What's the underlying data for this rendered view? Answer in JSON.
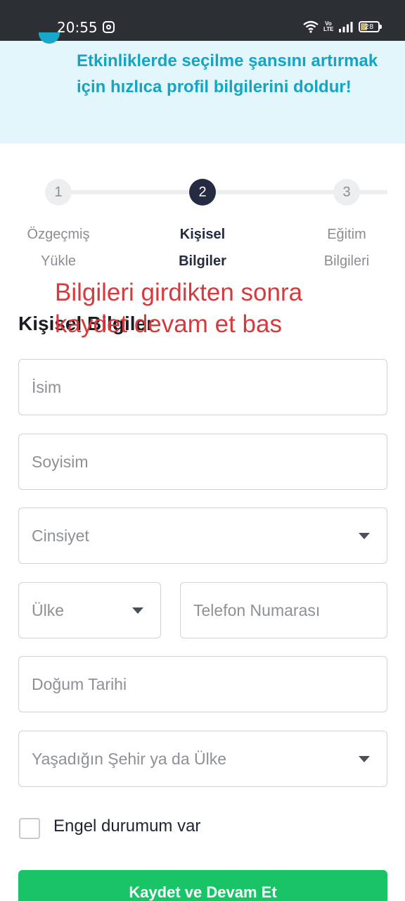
{
  "status_bar": {
    "time": "20:55",
    "battery": "28",
    "network_label": "Vo LTE"
  },
  "banner": {
    "text": "Etkinliklerde seçilme şansını artırmak için hızlıca profil bilgilerini doldur!",
    "accent_color": "#14a5c4",
    "background_color": "#e3f6fb"
  },
  "stepper": {
    "steps": [
      {
        "number": "1",
        "label_line1": "Özgeçmiş",
        "label_line2": "Yükle",
        "state": "inactive"
      },
      {
        "number": "2",
        "label_line1": "Kişisel",
        "label_line2": "Bilgiler",
        "state": "active"
      },
      {
        "number": "3",
        "label_line1": "Eğitim",
        "label_line2": "Bilgileri",
        "state": "inactive"
      }
    ]
  },
  "section_title": "Kişisel Bilgiler",
  "overlay_note": "Bilgileri girdikten sonra kaydet devam et bas",
  "form": {
    "name_placeholder": "İsim",
    "surname_placeholder": "Soyisim",
    "gender_placeholder": "Cinsiyet",
    "country_placeholder": "Ülke",
    "phone_placeholder": "Telefon Numarası",
    "birthdate_placeholder": "Doğum Tarihi",
    "city_placeholder": "Yaşadığın Şehir ya da Ülke",
    "disability_label": "Engel durumum var",
    "disability_checked": false,
    "submit_label": "Kaydet ve Devam Et"
  },
  "colors": {
    "primary_button": "#18c466",
    "active_step": "#252c41",
    "note_red": "#d8393b"
  }
}
